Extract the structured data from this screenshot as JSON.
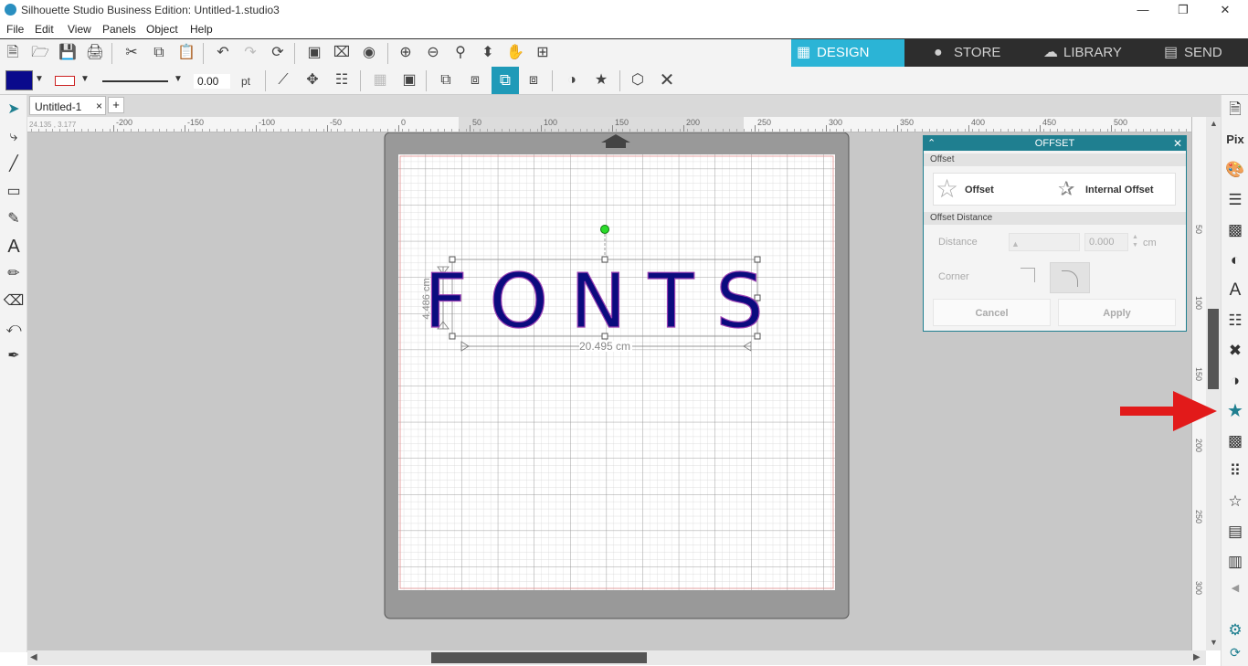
{
  "window": {
    "title": "Silhouette Studio Business Edition: Untitled-1.studio3",
    "minimize": "—",
    "restore": "❐",
    "close": "✕"
  },
  "menu": [
    "File",
    "Edit",
    "View",
    "Panels",
    "Object",
    "Help"
  ],
  "nav_tabs": [
    {
      "label": "DESIGN",
      "icon": "grid-icon",
      "active": true
    },
    {
      "label": "STORE",
      "icon": "s-logo-icon",
      "active": false
    },
    {
      "label": "LIBRARY",
      "icon": "cloud-icon",
      "active": false
    },
    {
      "label": "SEND",
      "icon": "cutter-icon",
      "active": false
    }
  ],
  "toolbar2": {
    "fill_color": "#0a0a8c",
    "line_color": "#cc2222",
    "line_width": "0.00",
    "line_unit": "pt"
  },
  "document": {
    "tab_label": "Untitled-1",
    "close": "×",
    "add": "+"
  },
  "ruler": {
    "coords": "24.135 , 3.177",
    "top_labels": [
      "-200",
      "-150",
      "-100",
      "-50",
      "0",
      "50",
      "100",
      "150",
      "200",
      "250",
      "300",
      "350",
      "400",
      "450",
      "500"
    ],
    "right_labels": [
      "50",
      "100",
      "150",
      "200",
      "250",
      "300"
    ]
  },
  "design": {
    "text": "FONTS",
    "text_color": "#0b0b7e",
    "height_label": "4.486 cm",
    "width_label": "20.495 cm"
  },
  "offset_panel": {
    "title": "OFFSET",
    "section_offset": "Offset",
    "offset_label": "Offset",
    "internal_offset_label": "Internal Offset",
    "section_distance": "Offset Distance",
    "distance_label": "Distance",
    "distance_value": "0.000",
    "distance_unit": "cm",
    "corner_label": "Corner",
    "cancel_label": "Cancel",
    "apply_label": "Apply"
  },
  "colors": {
    "accent": "#1f7f90",
    "design_tab": "#2bb4d6",
    "dark_bar": "#2d2d2d",
    "canvas": "#c8c8c8",
    "arrow": "#e21a1a"
  }
}
